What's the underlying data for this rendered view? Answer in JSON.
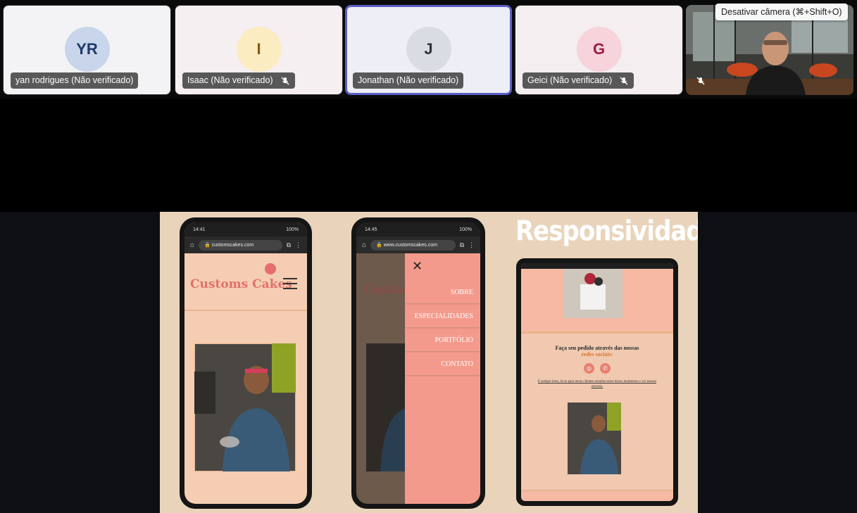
{
  "participants": [
    {
      "initials": "YR",
      "name": "yan rodrigues (Não verificado)",
      "muted": false,
      "bg": "#f3f3f5",
      "avatar_bg": "#c9d5ea",
      "avatar_fg": "#1f3a6b"
    },
    {
      "initials": "I",
      "name": "Isaac (Não verificado)",
      "muted": true,
      "bg": "#f5eff2",
      "avatar_bg": "#fbecc1",
      "avatar_fg": "#8a5a00"
    },
    {
      "initials": "J",
      "name": "Jonathan (Não verificado)",
      "muted": false,
      "bg": "#eeeef6",
      "avatar_bg": "#d9dde3",
      "avatar_fg": "#2d333a",
      "active": true
    },
    {
      "initials": "G",
      "name": "Geici (Não verificado)",
      "muted": true,
      "bg": "#f4eef0",
      "avatar_bg": "#f7d3dc",
      "avatar_fg": "#9a1c46"
    }
  ],
  "camera": {
    "muted": true,
    "tooltip": "Desativar câmera (⌘+Shift+O)"
  },
  "slide": {
    "title": "Responsividade",
    "phone1": {
      "time": "14:41",
      "battery": "100%",
      "url": "customscakes.com",
      "brand": "Customs Cakes"
    },
    "phone2": {
      "time": "14:45",
      "battery": "100%",
      "url": "www.customscakes.com",
      "brand": "Custom",
      "menu": [
        "SOBRE",
        "ESPECIALIDADES",
        "PORTFÓLIO",
        "CONTATO"
      ]
    },
    "tablet": {
      "heading": "Faça seu pedido através das nossas",
      "link": "redes sociais:",
      "note": "É sempre bom, levar para meus clientes amados esses doces momentos e ver nossos sucesso."
    }
  },
  "colors": {
    "accent": "#5b5fc7",
    "slide_bg": "#e9d4bb",
    "brand": "#e2706b",
    "menu_bg": "#f49a8c"
  }
}
